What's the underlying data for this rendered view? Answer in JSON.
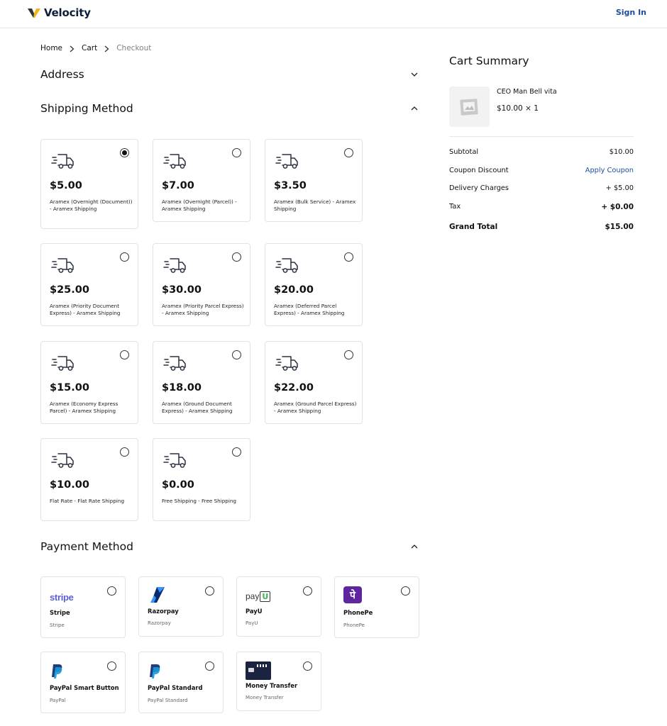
{
  "header": {
    "brand": "Velocity",
    "signin": "Sign In"
  },
  "breadcrumb": {
    "home": "Home",
    "cart": "Cart",
    "current": "Checkout"
  },
  "sections": {
    "address": "Address",
    "shipping": "Shipping Method",
    "payment": "Payment Method"
  },
  "shipping_options": [
    {
      "price": "$5.00",
      "desc": "Aramex (Overnight (Document)) - Aramex Shipping",
      "selected": true
    },
    {
      "price": "$7.00",
      "desc": "Aramex (Overnight (Parcel)) - Aramex Shipping",
      "selected": false
    },
    {
      "price": "$3.50",
      "desc": "Aramex (Bulk Service) - Aramex Shipping",
      "selected": false
    },
    {
      "price": "$25.00",
      "desc": "Aramex (Priority Document Express) - Aramex Shipping",
      "selected": false
    },
    {
      "price": "$30.00",
      "desc": "Aramex (Priority Parcel Express) - Aramex Shipping",
      "selected": false
    },
    {
      "price": "$20.00",
      "desc": "Aramex (Deferred Parcel Express) - Aramex Shipping",
      "selected": false
    },
    {
      "price": "$15.00",
      "desc": "Aramex (Economy Express Parcel) - Aramex Shipping",
      "selected": false
    },
    {
      "price": "$18.00",
      "desc": "Aramex (Ground Document Express) - Aramex Shipping",
      "selected": false
    },
    {
      "price": "$22.00",
      "desc": "Aramex (Ground Parcel Express) - Aramex Shipping",
      "selected": false
    },
    {
      "price": "$10.00",
      "desc": "Flat Rate - Flat Rate Shipping",
      "selected": false
    },
    {
      "price": "$0.00",
      "desc": "Free Shipping - Free Shipping",
      "selected": false
    }
  ],
  "payment_options": [
    {
      "logo_text": "stripe",
      "icon": "stripe-logo",
      "name": "Stripe",
      "sub": "Stripe"
    },
    {
      "logo_text": "",
      "icon": "razorpay-logo",
      "name": "Razorpay",
      "sub": "Razorpay"
    },
    {
      "logo_text": "pay",
      "icon": "payu-logo",
      "name": "PayU",
      "sub": "PayU"
    },
    {
      "logo_text": "",
      "icon": "phonepe-logo",
      "name": "PhonePe",
      "sub": "PhonePe"
    },
    {
      "logo_text": "",
      "icon": "paypal-logo",
      "name": "PayPal Smart Button",
      "sub": "PayPal"
    },
    {
      "logo_text": "",
      "icon": "paypal-logo",
      "name": "PayPal Standard",
      "sub": "PayPal Standard"
    },
    {
      "logo_text": "",
      "icon": "money-transfer-icon",
      "name": "Money Transfer",
      "sub": "Money Transfer"
    }
  ],
  "summary": {
    "title": "Cart Summary",
    "product_name": "CEO Man Bell vita",
    "product_qty": "$10.00 × 1",
    "subtotal_label": "Subtotal",
    "subtotal": "$10.00",
    "coupon_label": "Coupon Discount",
    "coupon_action": "Apply Coupon",
    "delivery_label": "Delivery Charges",
    "delivery": "+ $5.00",
    "tax_label": "Tax",
    "tax": "+ $0.00",
    "grand_label": "Grand Total",
    "grand": "$15.00"
  },
  "colors": {
    "accent": "#1a4fa0",
    "logo_gold": "#f2b51c",
    "brand_navy": "#0b1f3a"
  }
}
